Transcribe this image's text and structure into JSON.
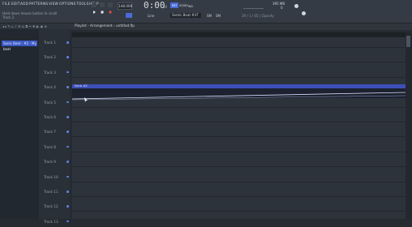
{
  "menu": [
    "FILE",
    "EDIT",
    "ADD",
    "PATTERNS",
    "VIEW",
    "OPTIONS",
    "TOOLS",
    "HELP"
  ],
  "hint_line1": "Hold down mouse button to scroll",
  "hint_line2": "Track 2",
  "tempo": "148.000",
  "time": "0:00",
  "time_small": "00",
  "mode_pat": "PAT",
  "mode_song": "SONG",
  "snap_label": "Line",
  "pattern_select": "Sentic Beat #47",
  "cpu_label": "395 MB",
  "cpu_value": "0",
  "bottom_info": "29 / 1 / 05 | Opacity",
  "breadcrumb": "Playlist - Arrangement › untitled.flp",
  "pattern_chip": "Sonic Beat - #2 · My beat",
  "tracks": [
    "Track 1",
    "Track 2",
    "Track 3",
    "Track 4",
    "Track 5",
    "Track 6",
    "Track 7",
    "Track 8",
    "Track 9",
    "Track 10",
    "Track 11",
    "Track 12",
    "Track 13"
  ],
  "clip_label": "Sonic #2",
  "colors": {
    "accent": "#3d4fb8",
    "dot": "#5f7fe8",
    "bg": "#2d333b"
  }
}
